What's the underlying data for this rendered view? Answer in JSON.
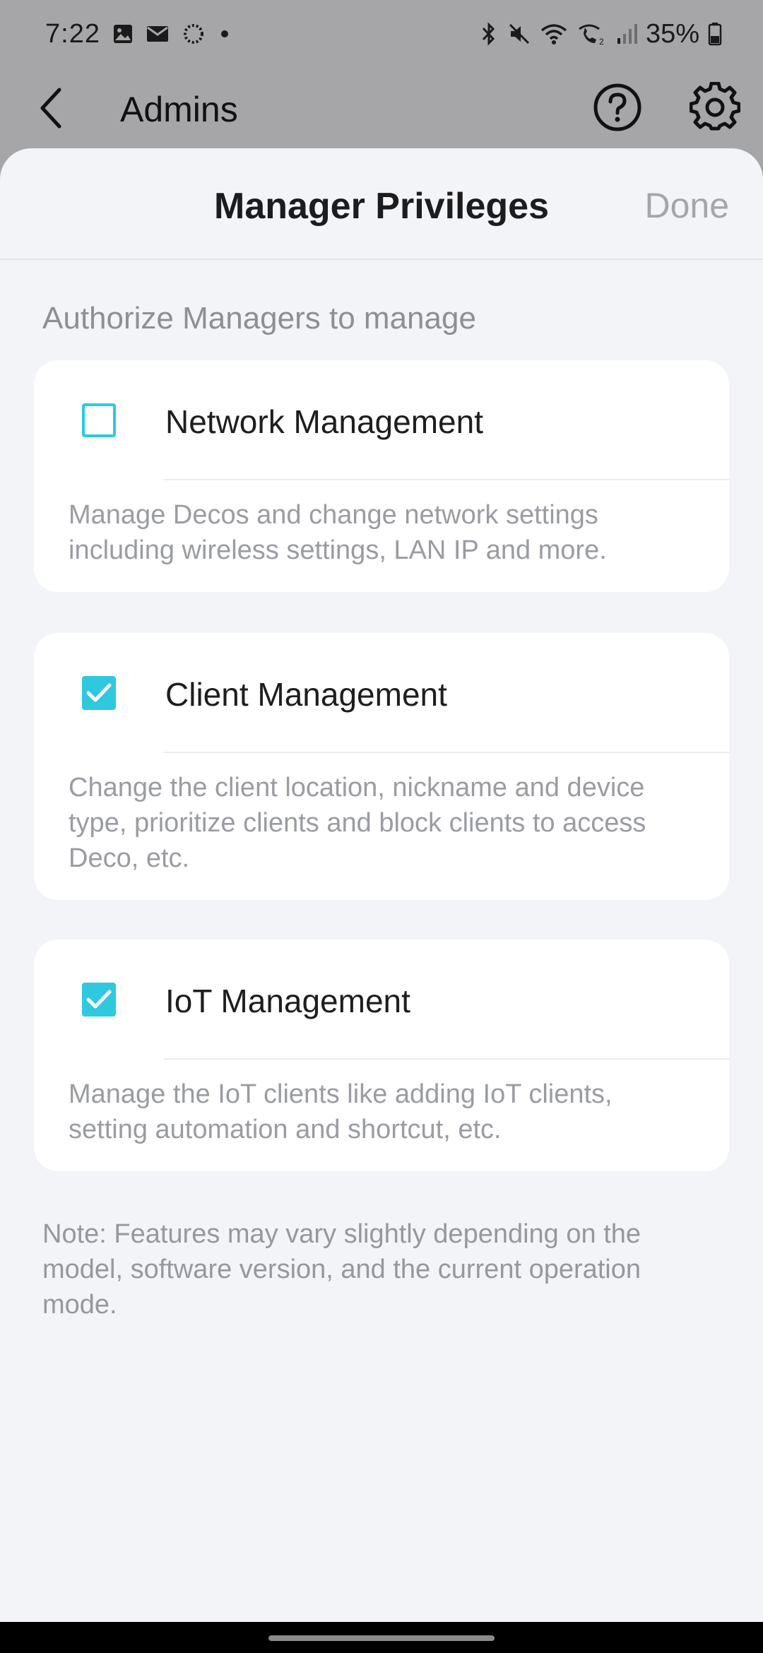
{
  "status_bar": {
    "time": "7:22",
    "battery": "35%",
    "left_icons": [
      "gallery-icon",
      "mail-icon",
      "sync-icon",
      "dot-icon"
    ],
    "right_icons": [
      "bluetooth-icon",
      "mute-icon",
      "wifi-icon",
      "wifi-calling-icon",
      "signal-icon",
      "battery-icon"
    ]
  },
  "background_header": {
    "title": "Admins",
    "icons": [
      "back-arrow-icon",
      "help-icon",
      "gear-icon"
    ]
  },
  "sheet": {
    "title": "Manager Privileges",
    "done_label": "Done",
    "section_label": "Authorize Managers to manage",
    "privileges": [
      {
        "title": "Network Management",
        "checked": false,
        "description": "Manage Decos and change network settings including wireless settings, LAN IP and more."
      },
      {
        "title": "Client Management",
        "checked": true,
        "description": "Change the client location, nickname and device type, prioritize clients and block clients to access Deco, etc."
      },
      {
        "title": "IoT Management",
        "checked": true,
        "description": "Manage the IoT clients like adding IoT clients, setting automation and shortcut, etc."
      }
    ],
    "note": "Note: Features may vary slightly depending on the model, software version, and the current operation mode."
  },
  "colors": {
    "accent": "#2ec9de",
    "sheet_background": "#f3f4f8",
    "dim_overlay": "#a6a6a8"
  }
}
